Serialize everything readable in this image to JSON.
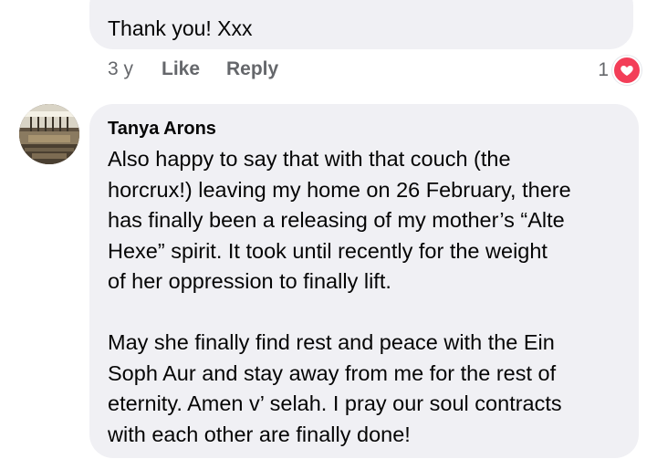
{
  "previous_comment": {
    "text": "Thank you! Xxx",
    "time": "3 y",
    "like_label": "Like",
    "reply_label": "Reply",
    "reaction_count": "1",
    "reaction_icon": "heart-icon",
    "reaction_color": "#f33e58"
  },
  "comment": {
    "author": "Tanya Arons",
    "paragraph1": [
      "Also happy to say that with that couch (the",
      "horcrux!) leaving my home on 26 February, there",
      "has finally been a releasing of my mother’s “Alte",
      "Hexe” spirit.  It took until recently for the weight",
      "of her oppression to finally lift."
    ],
    "paragraph2": [
      "May she finally find rest and peace with the Ein",
      "Soph Aur  and stay away from me for the rest of",
      "eternity.  Amen v’ selah. I pray our soul contracts",
      "with each other are finally done!"
    ]
  },
  "colors": {
    "bubble": "#f0f0f4",
    "meta_text": "#65676b",
    "text": "#050505"
  }
}
